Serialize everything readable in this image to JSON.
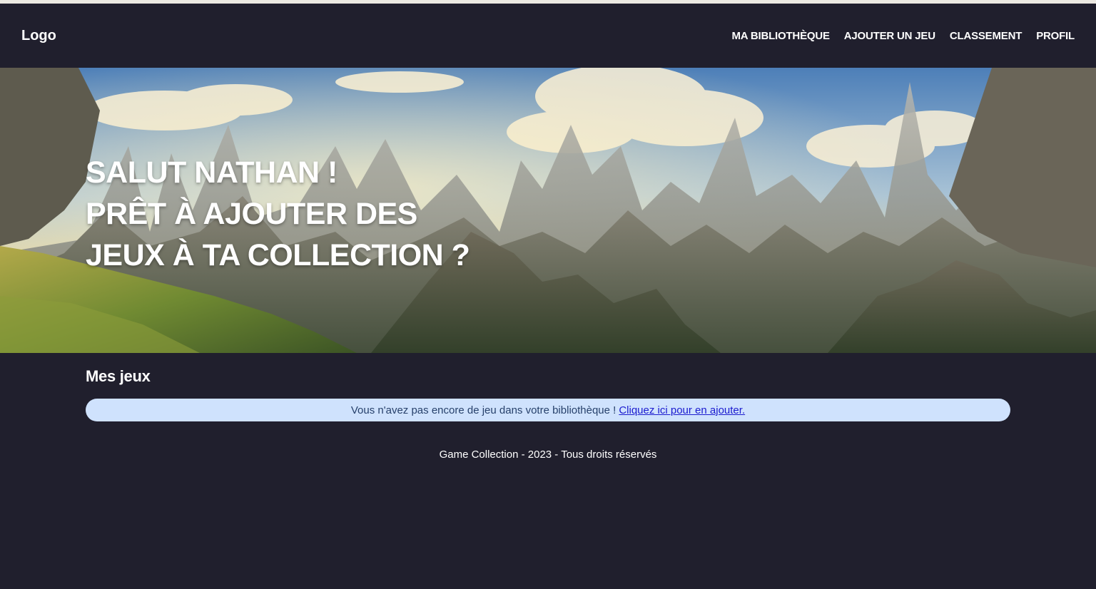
{
  "header": {
    "logo": "Logo",
    "nav": [
      "MA BIBLIOTHÈQUE",
      "AJOUTER UN JEU",
      "CLASSEMENT",
      "PROFIL"
    ]
  },
  "hero": {
    "line1": "SALUT NATHAN !",
    "line2": "PRÊT À AJOUTER DES",
    "line3": "JEUX À TA COLLECTION ?"
  },
  "main": {
    "section_title": "Mes jeux",
    "alert_text": "Vous n'avez pas encore de jeu dans votre bibliothèque !",
    "alert_link": "Cliquez ici pour en ajouter."
  },
  "footer": {
    "text": "Game Collection - 2023 - Tous droits réservés"
  },
  "colors": {
    "background": "#201f2d",
    "alert_bg": "#cfe2fd",
    "alert_text": "#27416b",
    "link": "#1b1bcf"
  }
}
